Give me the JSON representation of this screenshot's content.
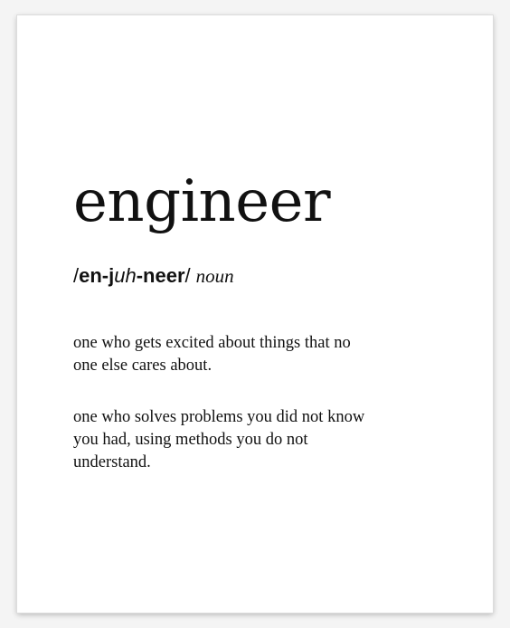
{
  "entry": {
    "word": "engineer",
    "pronunciation": {
      "open_slash": "/",
      "part1": "en-j",
      "part2_italic": "uh",
      "part3": "-neer",
      "close_slash": "/"
    },
    "part_of_speech": "noun",
    "definitions": [
      "one who gets excited about things that no\none else cares about.",
      "one who solves problems you did not know\nyou had, using methods you do not\nunderstand."
    ]
  }
}
